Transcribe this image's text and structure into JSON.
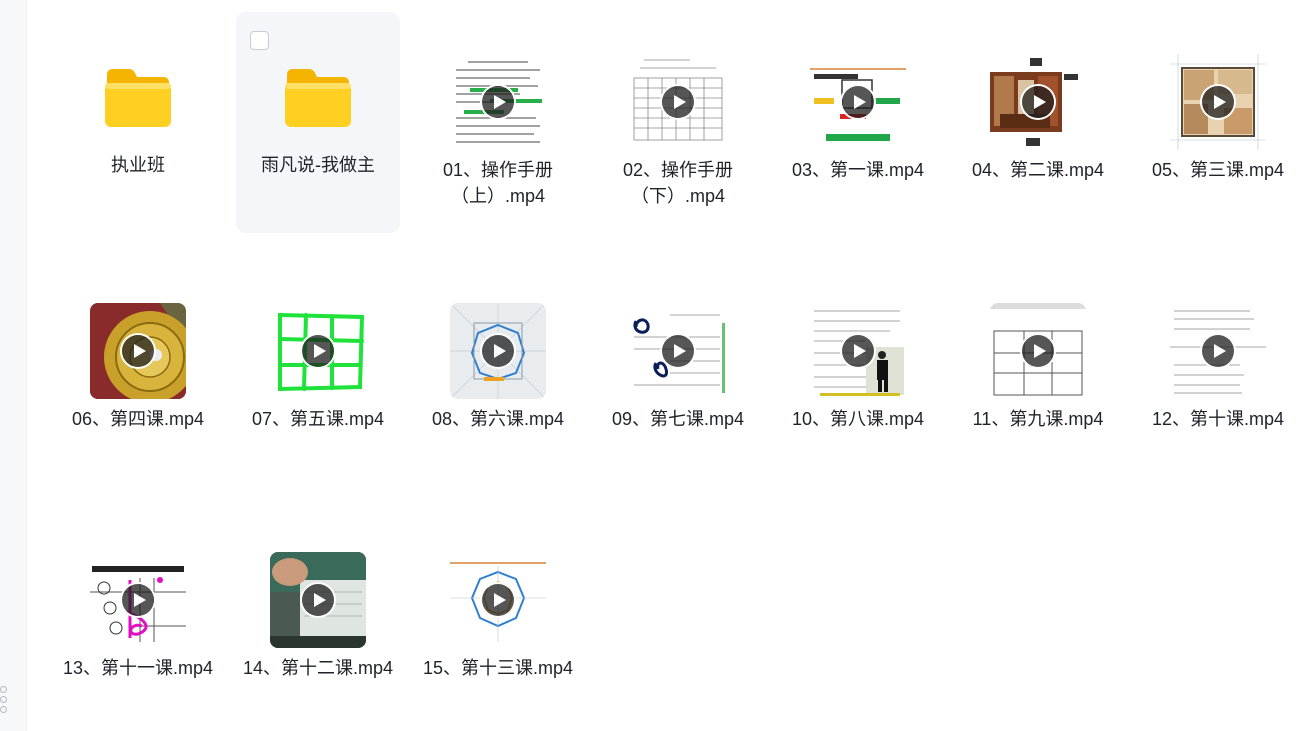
{
  "items": [
    {
      "type": "folder",
      "name": "执业班"
    },
    {
      "type": "folder",
      "name": "雨凡说-我做主",
      "selected": true
    },
    {
      "type": "video",
      "name": "01、操作手册（上）.mp4",
      "thumb": "doc-green"
    },
    {
      "type": "video",
      "name": "02、操作手册（下）.mp4",
      "thumb": "doc-table"
    },
    {
      "type": "video",
      "name": "03、第一课.mp4",
      "thumb": "slide-text"
    },
    {
      "type": "video",
      "name": "04、第二课.mp4",
      "thumb": "room-photo"
    },
    {
      "type": "video",
      "name": "05、第三课.mp4",
      "thumb": "floor-plan"
    },
    {
      "type": "video",
      "name": "06、第四课.mp4",
      "thumb": "compass-photo"
    },
    {
      "type": "video",
      "name": "07、第五课.mp4",
      "thumb": "green-grid"
    },
    {
      "type": "video",
      "name": "08、第六课.mp4",
      "thumb": "plan-bagua"
    },
    {
      "type": "video",
      "name": "09、第七课.mp4",
      "thumb": "doc-ink"
    },
    {
      "type": "video",
      "name": "10、第八课.mp4",
      "thumb": "doc-person"
    },
    {
      "type": "video",
      "name": "11、第九课.mp4",
      "thumb": "grid-plain"
    },
    {
      "type": "video",
      "name": "12、第十课.mp4",
      "thumb": "doc-lines"
    },
    {
      "type": "video",
      "name": "13、第十一课.mp4",
      "thumb": "chart-magenta"
    },
    {
      "type": "video",
      "name": "14、第十二课.mp4",
      "thumb": "hand-video"
    },
    {
      "type": "video",
      "name": "15、第十三课.mp4",
      "thumb": "bagua-plan"
    }
  ],
  "colors": {
    "accent": "#ffd021",
    "selected_bg": "#f5f6fa",
    "text": "#1f2329"
  }
}
